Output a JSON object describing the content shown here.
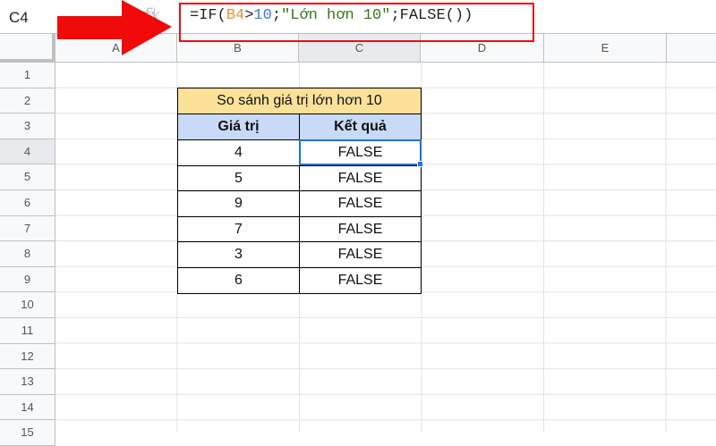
{
  "name_box": "C4",
  "formula": {
    "prefix": "=IF(",
    "ref": "B4",
    "op": ">",
    "num": "10",
    "sep1": ";",
    "str": "\"Lớn hơn 10\"",
    "rest": ";FALSE())"
  },
  "fx_label": "fx",
  "columns": [
    "A",
    "B",
    "C",
    "D",
    "E"
  ],
  "rows": [
    "1",
    "2",
    "3",
    "4",
    "5",
    "6",
    "7",
    "8",
    "9",
    "10",
    "11",
    "12",
    "13",
    "14",
    "15"
  ],
  "selected_cell": "C4",
  "table": {
    "title": "So sánh giá trị lớn hơn 10",
    "headers": [
      "Giá trị",
      "Kết quả"
    ],
    "rows": [
      [
        "4",
        "FALSE"
      ],
      [
        "5",
        "FALSE"
      ],
      [
        "9",
        "FALSE"
      ],
      [
        "7",
        "FALSE"
      ],
      [
        "3",
        "FALSE"
      ],
      [
        "6",
        "FALSE"
      ]
    ]
  },
  "colors": {
    "highlight": "#e3111a",
    "title_bg": "#fce199",
    "header_bg": "#c9daf8",
    "selection": "#1a73e8"
  }
}
